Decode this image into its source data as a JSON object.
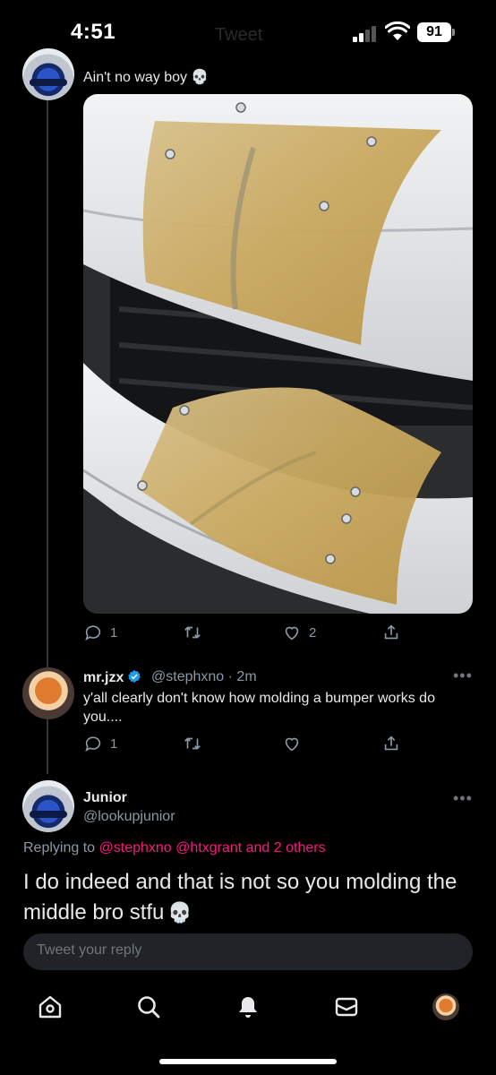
{
  "status_bar": {
    "time": "4:51",
    "battery": "91",
    "faded_title": "Tweet"
  },
  "posts": [
    {
      "text": "Ain't no way boy",
      "emoji": "💀",
      "avatar": "car-avatar",
      "media": "bumper-photo",
      "stats": {
        "replies": "1",
        "retweets": "",
        "likes": "2"
      }
    },
    {
      "name": "mr.jzx",
      "verified": true,
      "handle": "@stephxno",
      "time_sep": "·",
      "time": "2m",
      "text": "y'all clearly don't know how molding a bumper works do you....",
      "avatar": "hamster-avatar",
      "stats": {
        "replies": "1",
        "retweets": "",
        "likes": ""
      }
    }
  ],
  "focused": {
    "name": "Junior",
    "handle": "@lookupjunior",
    "replying_prefix": "Replying to ",
    "replying_users": "@stephxno @htxgrant",
    "replying_suffix": " and 2 others",
    "text": "I do indeed and that is not so you molding the middle bro stfu",
    "emoji": "💀"
  },
  "compose": {
    "placeholder": "Tweet your reply"
  },
  "tabs": [
    "home-icon",
    "search-icon",
    "notifications-icon",
    "messages-icon",
    "profile-avatar"
  ],
  "colors": {
    "background": "#000000",
    "text": "#e7e9ea",
    "muted": "#8b98a5",
    "link": "#f91880",
    "verified": "#1d9bf0"
  }
}
